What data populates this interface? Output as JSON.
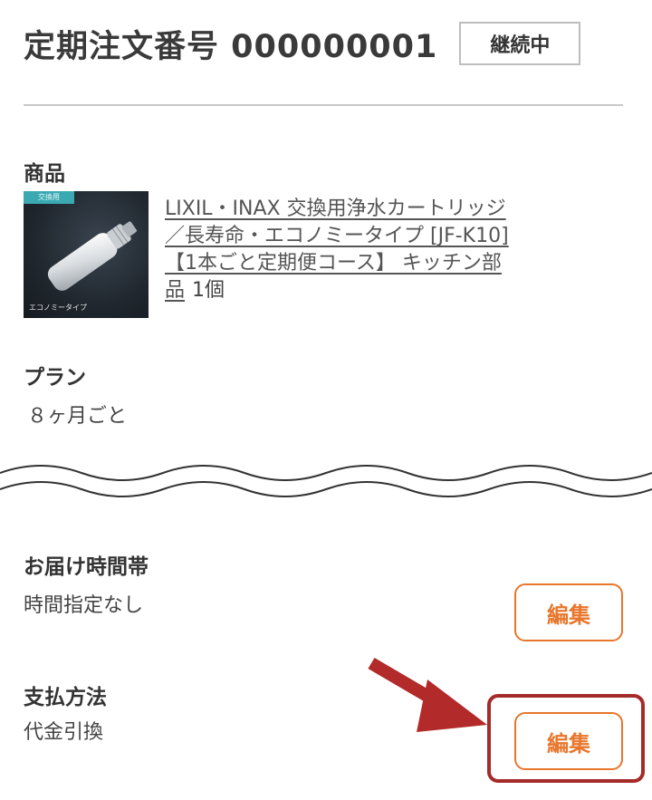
{
  "order": {
    "title": "定期注文番号 000000001",
    "status": "継続中"
  },
  "product": {
    "label": "商品",
    "thumbnail": {
      "tag": "交換用",
      "caption": "エコノミータイプ",
      "icon": "water-filter-cartridge"
    },
    "name": "LIXIL・INAX 交換用浄水カートリッジ／長寿命・エコノミータイプ [JF-K10] 【1本ごと定期便コース】 キッチン部品",
    "quantity": "1個"
  },
  "plan": {
    "label": "プラン",
    "value": "８ヶ月ごと"
  },
  "delivery_time": {
    "label": "お届け時間帯",
    "value": "時間指定なし",
    "edit_label": "編集"
  },
  "payment": {
    "label": "支払方法",
    "value": "代金引換",
    "edit_label": "編集"
  },
  "colors": {
    "accent": "#e8762c",
    "highlight": "#a52a2a",
    "arrow": "#b22a2a"
  }
}
